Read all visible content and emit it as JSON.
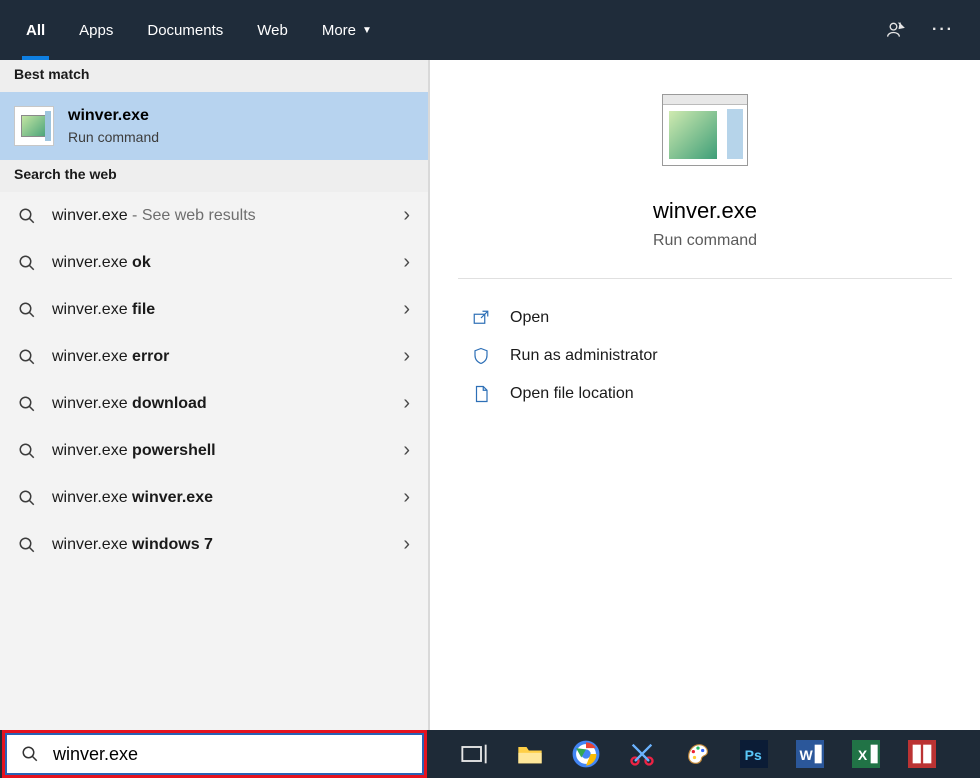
{
  "topbar": {
    "tabs": [
      "All",
      "Apps",
      "Documents",
      "Web",
      "More"
    ],
    "active_index": 0
  },
  "left": {
    "best_match_header": "Best match",
    "best_match": {
      "title": "winver.exe",
      "subtitle": "Run command"
    },
    "web_header": "Search the web",
    "web_items": [
      {
        "prefix": "winver.exe",
        "bold": "",
        "suffix": " - See web results",
        "suffix_grey": true
      },
      {
        "prefix": "winver.exe ",
        "bold": "ok",
        "suffix": ""
      },
      {
        "prefix": "winver.exe ",
        "bold": "file",
        "suffix": ""
      },
      {
        "prefix": "winver.exe ",
        "bold": "error",
        "suffix": ""
      },
      {
        "prefix": "winver.exe ",
        "bold": "download",
        "suffix": ""
      },
      {
        "prefix": "winver.exe ",
        "bold": "powershell",
        "suffix": ""
      },
      {
        "prefix": "winver.exe ",
        "bold": "winver.exe",
        "suffix": ""
      },
      {
        "prefix": "winver.exe ",
        "bold": "windows 7",
        "suffix": ""
      }
    ]
  },
  "right": {
    "title": "winver.exe",
    "subtitle": "Run command",
    "actions": [
      "Open",
      "Run as administrator",
      "Open file location"
    ]
  },
  "taskbar": {
    "search_value": "winver.exe",
    "apps": [
      "task-view",
      "file-explorer",
      "chrome",
      "snip",
      "paint",
      "photoshop",
      "word",
      "excel",
      "unknown-app"
    ]
  }
}
